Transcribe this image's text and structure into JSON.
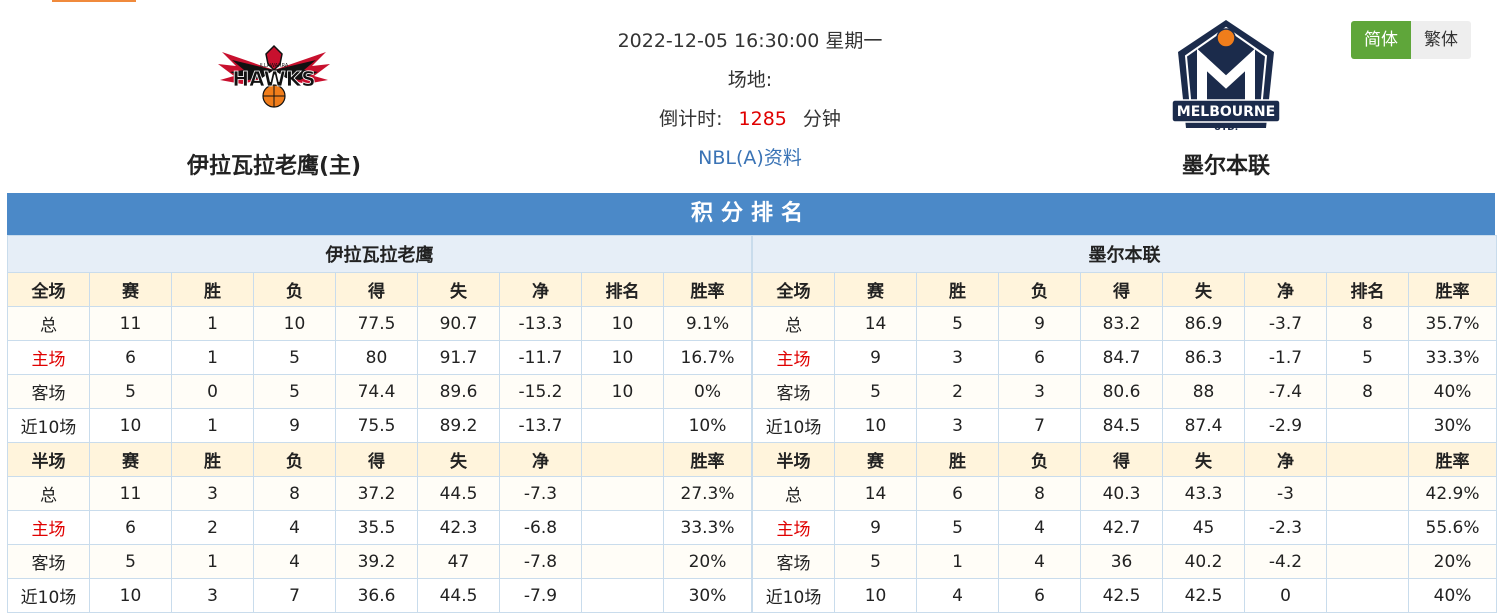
{
  "header": {
    "home_team": "伊拉瓦拉老鹰(主)",
    "away_team": "墨尔本联",
    "datetime": "2022-12-05 16:30:00 星期一",
    "venue_label": "场地:",
    "countdown_label": "倒计时:",
    "countdown_value": "1285",
    "countdown_unit": "分钟",
    "league_link": "NBL(A)资料"
  },
  "logos": {
    "home": {
      "main": "HAWKS",
      "small": "ILLAWARRA"
    },
    "away": {
      "main": "MELBOURNE",
      "sub": "UTD."
    }
  },
  "lang": {
    "simplified": "简体",
    "traditional": "繁体"
  },
  "standings": {
    "title": "积分排名",
    "home": {
      "team": "伊拉瓦拉老鹰",
      "full_header": [
        "全场",
        "赛",
        "胜",
        "负",
        "得",
        "失",
        "净",
        "排名",
        "胜率"
      ],
      "full_rows": [
        [
          "总",
          "11",
          "1",
          "10",
          "77.5",
          "90.7",
          "-13.3",
          "10",
          "9.1%"
        ],
        [
          "主场",
          "6",
          "1",
          "5",
          "80",
          "91.7",
          "-11.7",
          "10",
          "16.7%"
        ],
        [
          "客场",
          "5",
          "0",
          "5",
          "74.4",
          "89.6",
          "-15.2",
          "10",
          "0%"
        ],
        [
          "近10场",
          "10",
          "1",
          "9",
          "75.5",
          "89.2",
          "-13.7",
          "",
          "10%"
        ]
      ],
      "half_header": [
        "半场",
        "赛",
        "胜",
        "负",
        "得",
        "失",
        "净",
        "",
        "胜率"
      ],
      "half_rows": [
        [
          "总",
          "11",
          "3",
          "8",
          "37.2",
          "44.5",
          "-7.3",
          "",
          "27.3%"
        ],
        [
          "主场",
          "6",
          "2",
          "4",
          "35.5",
          "42.3",
          "-6.8",
          "",
          "33.3%"
        ],
        [
          "客场",
          "5",
          "1",
          "4",
          "39.2",
          "47",
          "-7.8",
          "",
          "20%"
        ],
        [
          "近10场",
          "10",
          "3",
          "7",
          "36.6",
          "44.5",
          "-7.9",
          "",
          "30%"
        ]
      ]
    },
    "away": {
      "team": "墨尔本联",
      "full_header": [
        "全场",
        "赛",
        "胜",
        "负",
        "得",
        "失",
        "净",
        "排名",
        "胜率"
      ],
      "full_rows": [
        [
          "总",
          "14",
          "5",
          "9",
          "83.2",
          "86.9",
          "-3.7",
          "8",
          "35.7%"
        ],
        [
          "主场",
          "9",
          "3",
          "6",
          "84.7",
          "86.3",
          "-1.7",
          "5",
          "33.3%"
        ],
        [
          "客场",
          "5",
          "2",
          "3",
          "80.6",
          "88",
          "-7.4",
          "8",
          "40%"
        ],
        [
          "近10场",
          "10",
          "3",
          "7",
          "84.5",
          "87.4",
          "-2.9",
          "",
          "30%"
        ]
      ],
      "half_header": [
        "半场",
        "赛",
        "胜",
        "负",
        "得",
        "失",
        "净",
        "",
        "胜率"
      ],
      "half_rows": [
        [
          "总",
          "14",
          "6",
          "8",
          "40.3",
          "43.3",
          "-3",
          "",
          "42.9%"
        ],
        [
          "主场",
          "9",
          "5",
          "4",
          "42.7",
          "45",
          "-2.3",
          "",
          "55.6%"
        ],
        [
          "客场",
          "5",
          "1",
          "4",
          "36",
          "40.2",
          "-4.2",
          "",
          "20%"
        ],
        [
          "近10场",
          "10",
          "4",
          "6",
          "42.5",
          "42.5",
          "0",
          "",
          "40%"
        ]
      ]
    }
  },
  "colors": {
    "accent_green": "#5fa63a",
    "header_blue": "#4b89c8",
    "highlight_red": "#e00000",
    "link_blue": "#3a73b5"
  }
}
